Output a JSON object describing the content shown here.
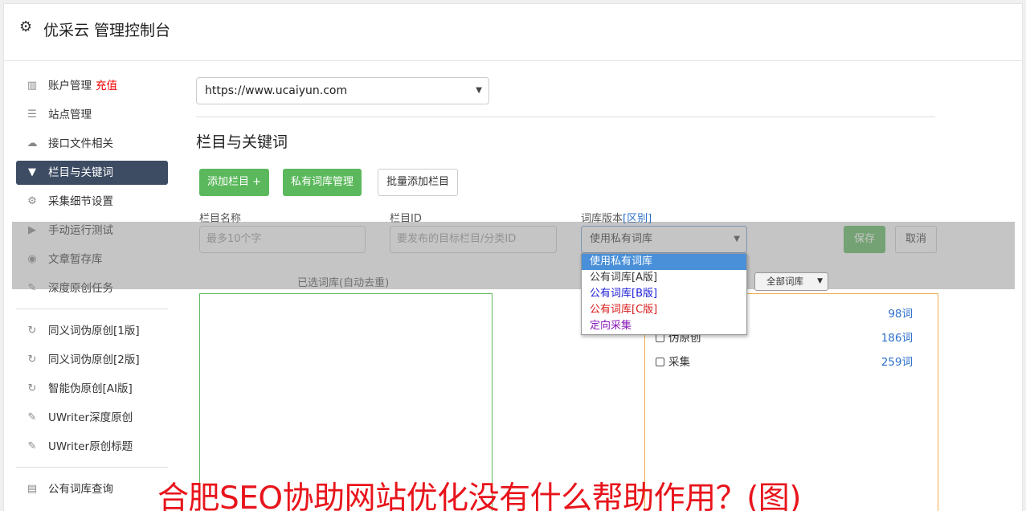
{
  "header": {
    "title": "优采云 管理控制台",
    "icon": "gear-icon"
  },
  "sidebar": {
    "items": [
      {
        "label": "账户管理",
        "extra": "充值",
        "icon": "bar-chart-icon"
      },
      {
        "label": "站点管理",
        "icon": "server-icon"
      },
      {
        "label": "接口文件相关",
        "icon": "cloud-upload-icon"
      },
      {
        "label": "栏目与关键词",
        "icon": "filter-icon",
        "active": true
      },
      {
        "label": "采集细节设置",
        "icon": "cogs-icon"
      },
      {
        "label": "手动运行测试",
        "icon": "play-circle-icon"
      },
      {
        "label": "文章暂存库",
        "icon": "database-icon"
      },
      {
        "label": "深度原创任务",
        "icon": "edit-icon"
      }
    ],
    "items2": [
      {
        "label": "同义词伪原创[1版]",
        "icon": "refresh-icon"
      },
      {
        "label": "同义词伪原创[2版]",
        "icon": "refresh-icon"
      },
      {
        "label": "智能伪原创[AI版]",
        "icon": "refresh-icon"
      },
      {
        "label": "UWriter深度原创",
        "icon": "edit-icon"
      },
      {
        "label": "UWriter原创标题",
        "icon": "edit-icon"
      }
    ],
    "items3": [
      {
        "label": "公有词库查询",
        "icon": "book-icon"
      }
    ]
  },
  "main": {
    "site_select": "https://www.ucaiyun.com",
    "section_title": "栏目与关键词",
    "buttons": {
      "add_column": "添加栏目 +",
      "private_lib": "私有词库管理",
      "batch_add": "批量添加栏目"
    },
    "form": {
      "name_label": "栏目名称",
      "name_placeholder": "最多10个字",
      "id_label": "栏目ID",
      "id_placeholder": "要发布的目标栏目/分类ID",
      "version_label": "词库版本",
      "version_link": "[区别]",
      "version_value": "使用私有词库",
      "save": "保存",
      "cancel": "取消"
    },
    "dropdown_options": [
      {
        "label": "使用私有词库",
        "color": "#ffffff",
        "selected": true
      },
      {
        "label": "公有词库[A版]",
        "color": "#333333"
      },
      {
        "label": "公有词库[B版]",
        "color": "#1a1ad8"
      },
      {
        "label": "公有词库[C版]",
        "color": "#d81a1a"
      },
      {
        "label": "定向采集",
        "color": "#8a1ab8"
      }
    ],
    "selected_title": "已选词库(自动去重)",
    "filter_select": "全部词库",
    "libraries": [
      {
        "label": "",
        "count": "98词"
      },
      {
        "label": "伪原创",
        "count": "186词"
      },
      {
        "label": "采集",
        "count": "259词"
      }
    ]
  },
  "caption": "合肥SEO协助网站优化没有什么帮助作用？(图)"
}
